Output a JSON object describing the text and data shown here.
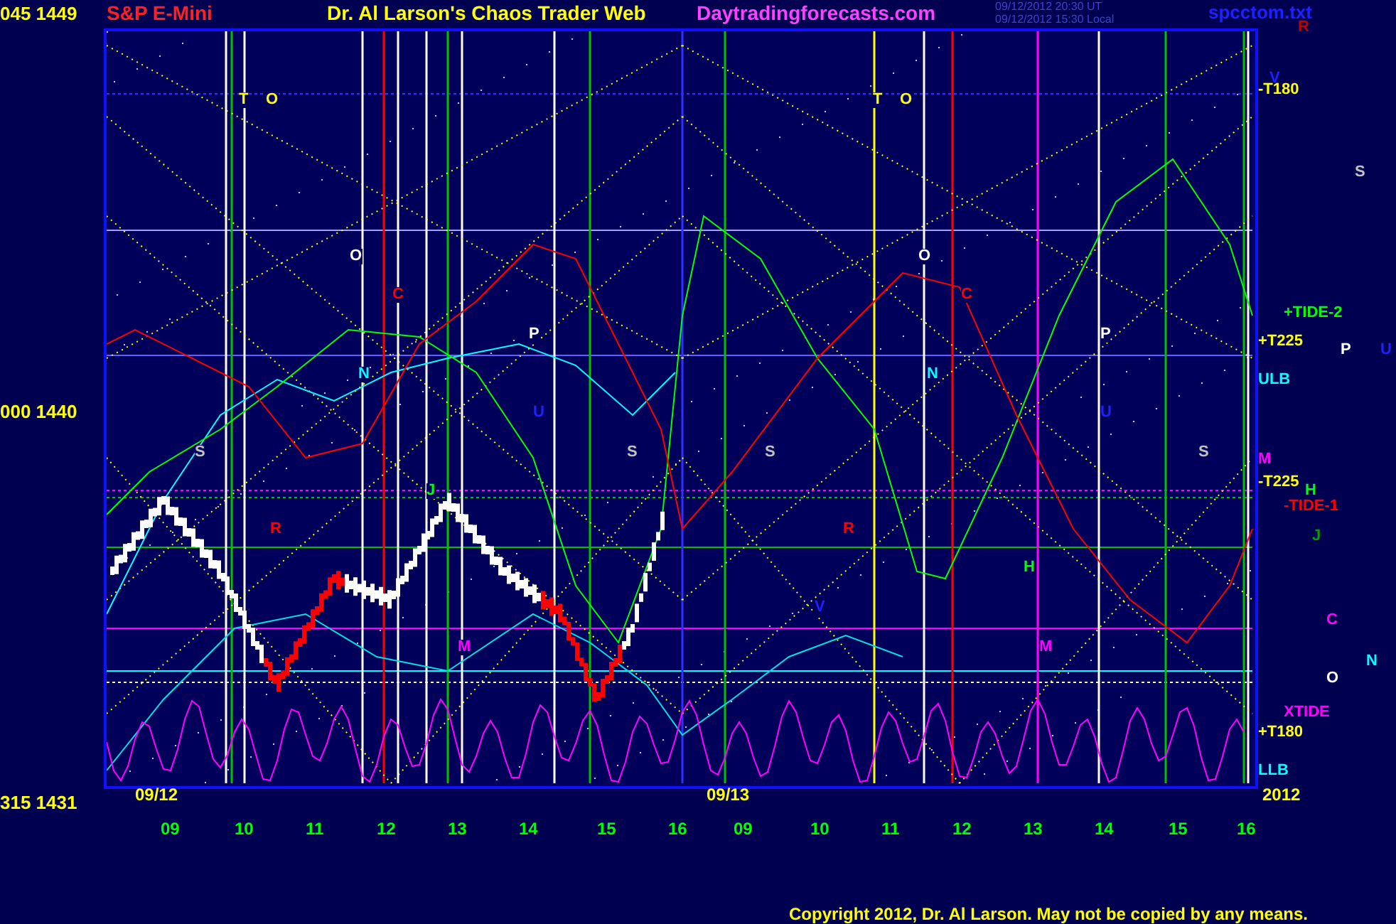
{
  "header": {
    "top_price": "045 1449",
    "instrument": "S&P E-Mini",
    "title": "Dr. Al Larson's Chaos Trader Web",
    "site": "Daytradingforecasts.com",
    "timestamps": [
      "09/12/2012 20:30 UT",
      "09/12/2012 15:30 Local"
    ],
    "file": "spcctom.txt"
  },
  "price_axis": [
    "000 1440",
    "315 1431"
  ],
  "date_labels": [
    "09/12",
    "09/13",
    "2012"
  ],
  "time_axis": [
    "09",
    "10",
    "11",
    "12",
    "13",
    "14",
    "15",
    "16",
    "09",
    "10",
    "11",
    "12",
    "13",
    "14",
    "15",
    "16"
  ],
  "plot_labels": [
    {
      "text": "T",
      "color": "#ffff00"
    },
    {
      "text": "O",
      "color": "#ffff00"
    },
    {
      "text": "T",
      "color": "#ffff00"
    },
    {
      "text": "O",
      "color": "#ffff00"
    },
    {
      "text": "O",
      "color": "#ffffff"
    },
    {
      "text": "C",
      "color": "#ff0000"
    },
    {
      "text": "P",
      "color": "#ffffff"
    },
    {
      "text": "N",
      "color": "#00ffff"
    },
    {
      "text": "U",
      "color": "#2020ff"
    },
    {
      "text": "S",
      "color": "#c0c0c0"
    },
    {
      "text": "S",
      "color": "#c0c0c0"
    },
    {
      "text": "J",
      "color": "#00ff00"
    },
    {
      "text": "R",
      "color": "#ff0000"
    },
    {
      "text": "M",
      "color": "#ff00ff"
    },
    {
      "text": "O",
      "color": "#ffffff"
    },
    {
      "text": "C",
      "color": "#ff0000"
    },
    {
      "text": "P",
      "color": "#ffffff"
    },
    {
      "text": "N",
      "color": "#00ffff"
    },
    {
      "text": "U",
      "color": "#2020ff"
    },
    {
      "text": "S",
      "color": "#c0c0c0"
    },
    {
      "text": "S",
      "color": "#c0c0c0"
    },
    {
      "text": "H",
      "color": "#00ff00"
    },
    {
      "text": "R",
      "color": "#ff0000"
    },
    {
      "text": "M",
      "color": "#ff00ff"
    },
    {
      "text": "V",
      "color": "#2020ff"
    }
  ],
  "side_labels": [
    {
      "text": "R",
      "color": "#c00000"
    },
    {
      "text": "V",
      "color": "#2020ff"
    },
    {
      "text": "-T180",
      "color": "#ffff00"
    },
    {
      "text": "S",
      "color": "#c0c0c0"
    },
    {
      "text": "+TIDE-2",
      "color": "#00ff00"
    },
    {
      "text": "+T225",
      "color": "#ffff00"
    },
    {
      "text": "P",
      "color": "#ffffff"
    },
    {
      "text": "U",
      "color": "#2020ff"
    },
    {
      "text": "ULB",
      "color": "#00ffff"
    },
    {
      "text": "M",
      "color": "#ff00ff"
    },
    {
      "text": "-T225",
      "color": "#ffff00"
    },
    {
      "text": "H",
      "color": "#00ff00"
    },
    {
      "text": "-TIDE-1",
      "color": "#ff0000"
    },
    {
      "text": "J",
      "color": "#00a000"
    },
    {
      "text": "C",
      "color": "#ff00ff"
    },
    {
      "text": "N",
      "color": "#00ffff"
    },
    {
      "text": "O",
      "color": "#ffffff"
    },
    {
      "text": "XTIDE",
      "color": "#ff00ff"
    },
    {
      "text": "+T180",
      "color": "#ffff00"
    },
    {
      "text": "LLB",
      "color": "#00ffff"
    }
  ],
  "copyright": "Copyright 2012, Dr. Al Larson. May not be copied by any means."
}
